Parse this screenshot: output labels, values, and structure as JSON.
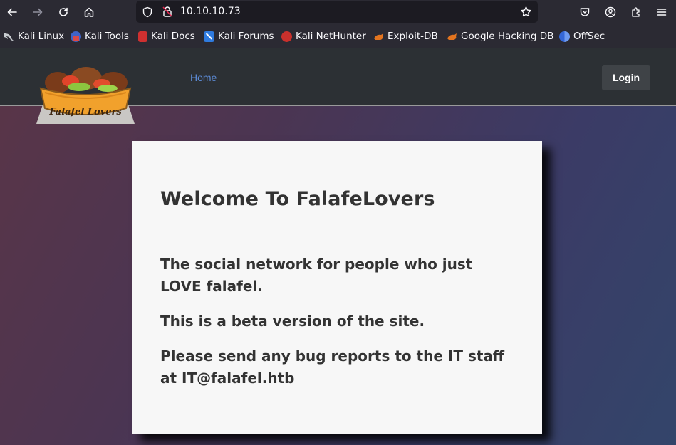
{
  "browser": {
    "url": "10.10.10.73",
    "bookmarks": [
      {
        "label": "Kali Linux",
        "icon": "kali-dragon-icon",
        "color": "#9aa0a6"
      },
      {
        "label": "Kali Tools",
        "icon": "kali-tools-icon",
        "color": "#5a7bd8"
      },
      {
        "label": "Kali Docs",
        "icon": "kali-docs-icon",
        "color": "#d23b3b"
      },
      {
        "label": "Kali Forums",
        "icon": "kali-forums-icon",
        "color": "#3e8ef7"
      },
      {
        "label": "Kali NetHunter",
        "icon": "nethunter-icon",
        "color": "#d23b3b"
      },
      {
        "label": "Exploit-DB",
        "icon": "exploit-db-icon",
        "color": "#e0701c"
      },
      {
        "label": "Google Hacking DB",
        "icon": "ghdb-icon",
        "color": "#e0701c"
      },
      {
        "label": "OffSec",
        "icon": "offsec-icon",
        "color": "#3d6fd8"
      }
    ]
  },
  "site": {
    "logo_text": "Falafel Lovers",
    "nav_home": "Home",
    "login_label": "Login",
    "accent": "#5c8ad4"
  },
  "card": {
    "title": "Welcome To FalafeLovers",
    "p1": "The social network for people who just LOVE falafel.",
    "p2": "This is a beta version of the site.",
    "p3": "Please send any bug reports to the IT staff at IT@falafel.htb"
  }
}
